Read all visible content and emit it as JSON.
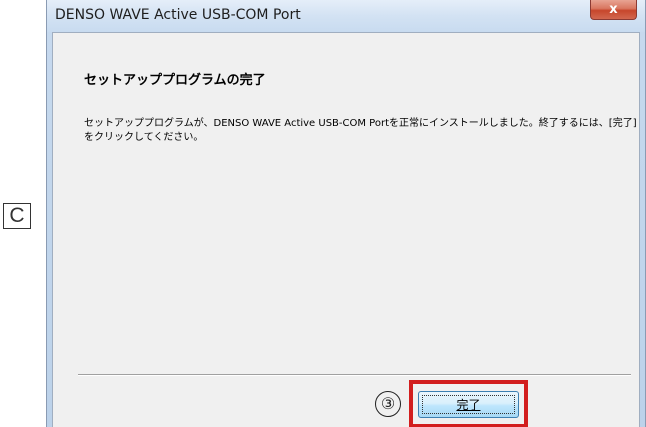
{
  "annotation": {
    "margin_label": "C",
    "step_number": "③",
    "highlight_color": "#d21e1e"
  },
  "window": {
    "title": "DENSO WAVE Active USB-COM Port",
    "close_icon": "close-icon",
    "close_glyph": "x",
    "close_color": "#c7462c"
  },
  "dialog": {
    "heading": "セットアッププログラムの完了",
    "message": "セットアッププログラムが、DENSO WAVE Active USB-COM Portを正常にインストールしました。終了するには、[完了]をクリックしてください。",
    "finish_button_label": "完了"
  }
}
